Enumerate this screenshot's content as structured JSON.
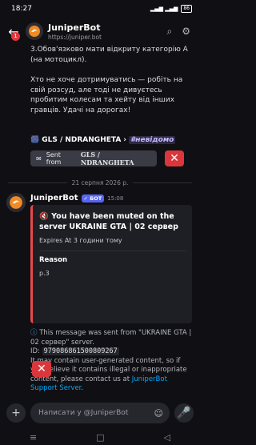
{
  "status": {
    "time": "18:27",
    "icons": "▮ ◂ ⊞ ✉",
    "signal": "▂▄▆ ▂▄▆",
    "battery": "86"
  },
  "header": {
    "name": "JuniperBot",
    "url": "https://juniper.bot",
    "badge": "1"
  },
  "messages": {
    "text1": "3.Обов'язково мати відкриту категорію А (на мотоцикл).",
    "text2": "Хто не хоче дотримуватись — робіть на свій розсуд, але тоді не дивуєтесь пробитим колесам та хейту від інших гравців. Удачі на дорогах!",
    "tag_main": "GLS / NDRANGHETA",
    "tag_hash": "#невідомо",
    "sent_from_prefix": "Sent from",
    "sent_from_name": "GLS / NDRANGHETA",
    "date_divider": "21 серпня 2026 р.",
    "author": "JuniperBot",
    "bot_badge": "✓ БОТ",
    "time": "15:08",
    "embed_title": "You have been muted on the server UKRAINE GTA | 02 сервер",
    "expires": "Expires At 3 години тому",
    "reason_label": "Reason",
    "reason_value": "p.3",
    "info_line1": "This message was sent from \"UKRAINE GTA | 02 сервер\" server.",
    "id_label": "ID:",
    "id_value": "979086861500809267",
    "info_line2": "It may contain user-generated content, so if you believe it contains illegal or inappropriate content, please contact us at",
    "info_link": "JuniperBot Support Server",
    "info_end": "."
  },
  "composer": {
    "placeholder": "Написати у @JuniperBot"
  },
  "colors": {
    "danger": "#da373c",
    "accent": "#5865f2",
    "link": "#00a8fc"
  },
  "icons": [
    "back-arrow-icon",
    "avatar-logo",
    "search-icon",
    "gear-icon",
    "speaker-muted-icon",
    "info-icon",
    "close-icon",
    "plus-icon",
    "gift-icon",
    "mic-icon"
  ]
}
